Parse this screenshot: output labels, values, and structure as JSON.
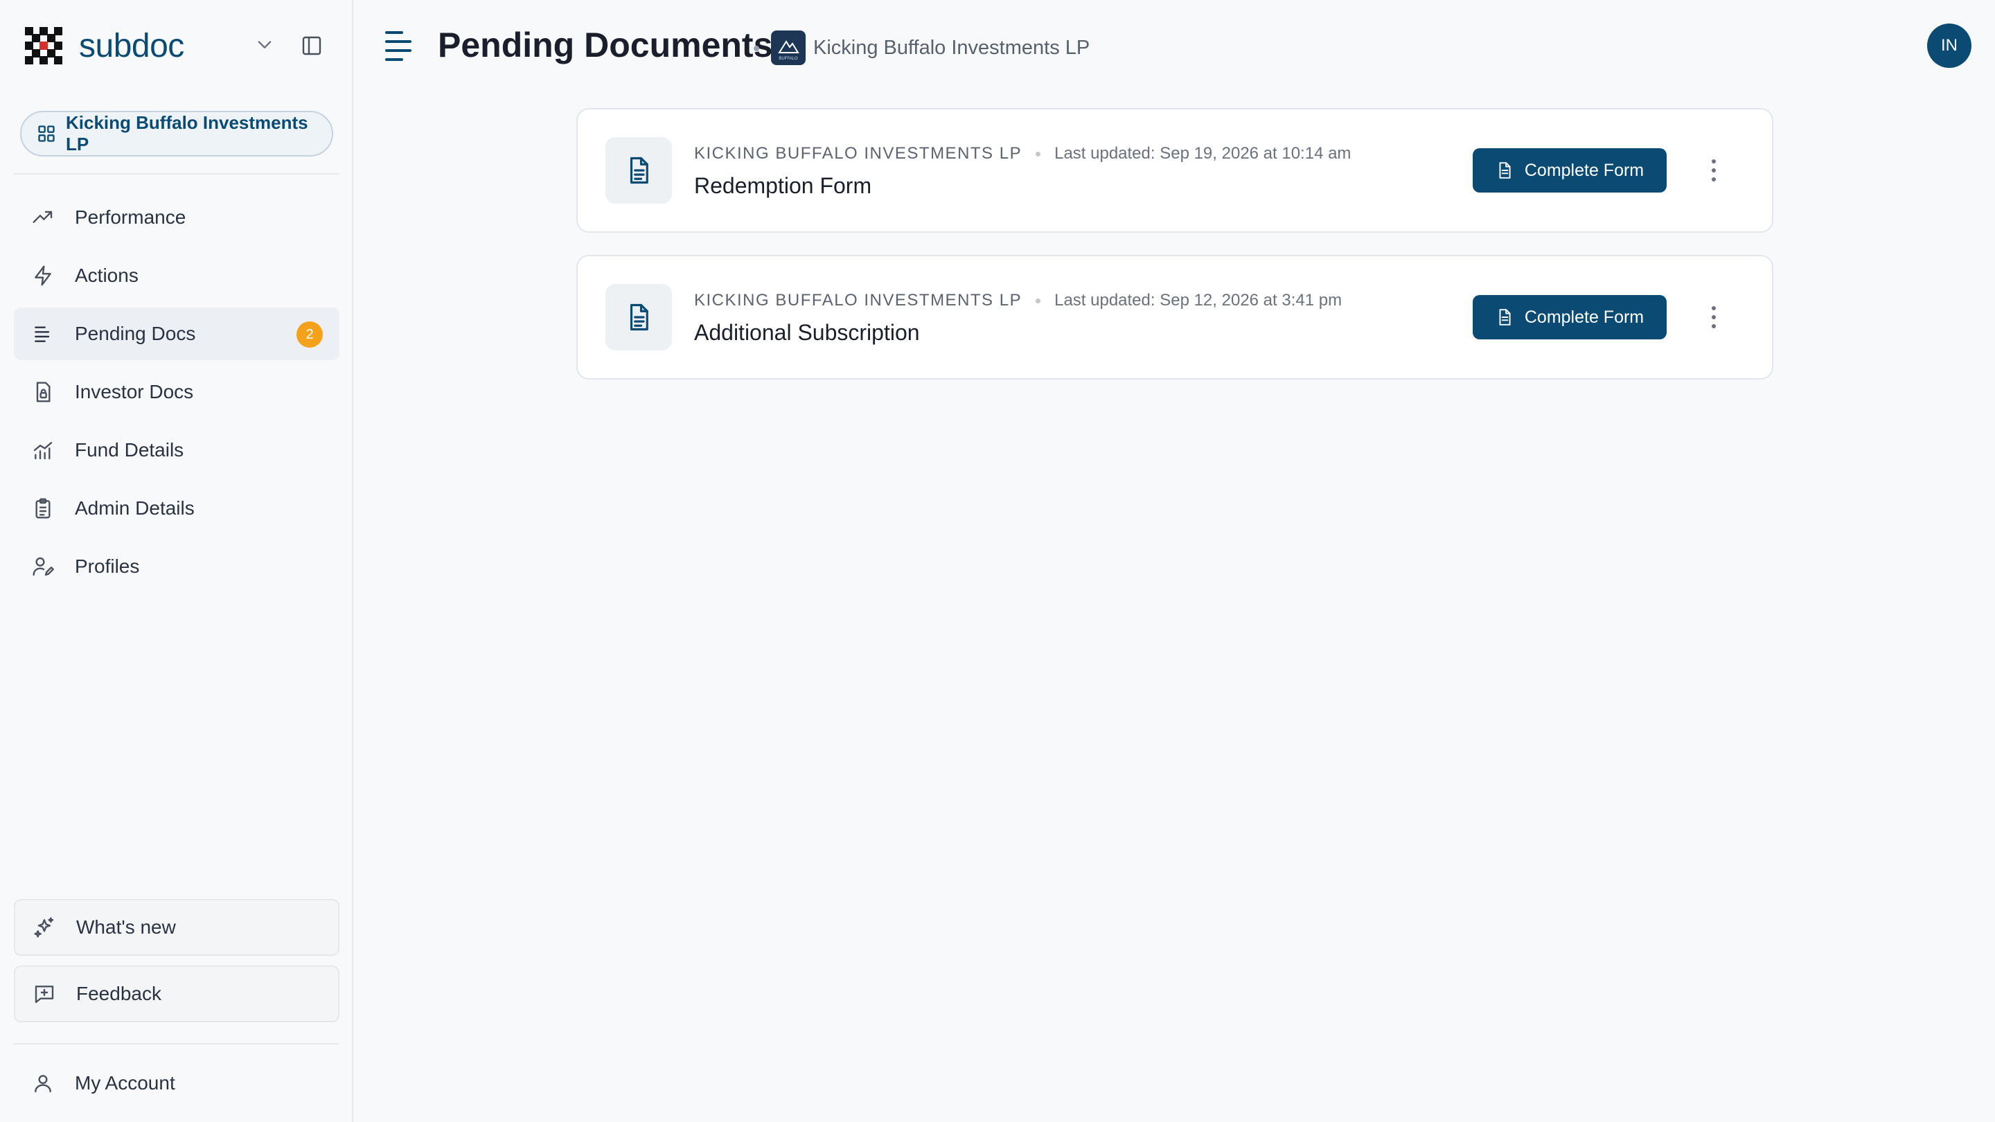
{
  "brand": {
    "name": "subdoc"
  },
  "sidebar": {
    "fund_selector": "Kicking Buffalo Investments LP",
    "items": [
      {
        "label": "Performance",
        "icon": "trending-up-icon"
      },
      {
        "label": "Actions",
        "icon": "lightning-icon"
      },
      {
        "label": "Pending Docs",
        "icon": "list-icon",
        "badge": "2",
        "active": true
      },
      {
        "label": "Investor Docs",
        "icon": "document-lock-icon"
      },
      {
        "label": "Fund Details",
        "icon": "bar-chart-icon"
      },
      {
        "label": "Admin Details",
        "icon": "clipboard-icon"
      },
      {
        "label": "Profiles",
        "icon": "user-edit-icon"
      }
    ],
    "whats_new": "What's new",
    "feedback": "Feedback",
    "account": "My Account"
  },
  "header": {
    "title": "Pending Documents",
    "fund": "Kicking Buffalo Investments LP",
    "fund_logo_text": "BUFFALO",
    "avatar_initials": "IN"
  },
  "documents": [
    {
      "fund": "KICKING BUFFALO INVESTMENTS LP",
      "updated": "Last updated: Sep 19, 2026 at 10:14 am",
      "title": "Redemption Form",
      "action": "Complete Form"
    },
    {
      "fund": "KICKING BUFFALO INVESTMENTS LP",
      "updated": "Last updated: Sep 12, 2026 at 3:41 pm",
      "title": "Additional Subscription",
      "action": "Complete Form"
    }
  ],
  "colors": {
    "brand": "#0b4a73",
    "badge": "#f5a21b",
    "background": "#f8f9fb"
  }
}
